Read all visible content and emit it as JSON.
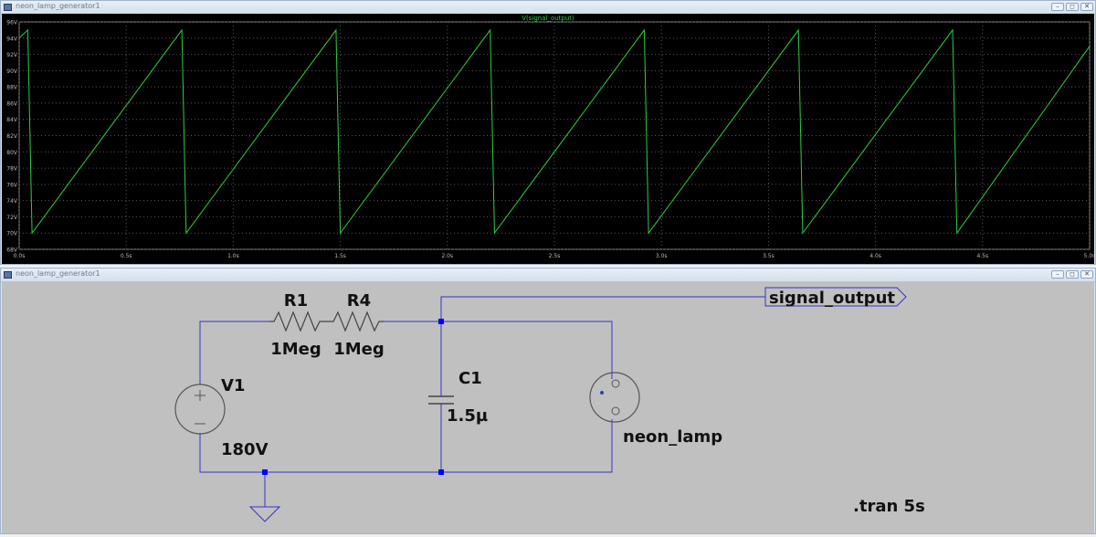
{
  "waveform_window": {
    "title": "neon_lamp_generator1",
    "trace_label": "V(signal_output)"
  },
  "schematic_window": {
    "title": "neon_lamp_generator1"
  },
  "window_controls": {
    "minimize": "–",
    "restore": "◻",
    "close": "✕"
  },
  "icons": {
    "app": "ltspice-app-icon",
    "minimize": "minimize-icon",
    "restore": "restore-icon",
    "close": "close-icon"
  },
  "colors": {
    "plot_background": "#000000",
    "trace": "#2ecc40",
    "grid": "#555555",
    "axis_text": "#bbbbbb",
    "wire": "#3333cc",
    "junction": "#0000ff",
    "schematic_background": "#c0c0c0"
  },
  "chart_data": {
    "type": "line",
    "title": "V(signal_output)",
    "xlabel": "",
    "ylabel": "",
    "xlim": [
      0,
      5
    ],
    "ylim": [
      68,
      96
    ],
    "x_ticks": [
      "0.0s",
      "0.5s",
      "1.0s",
      "1.5s",
      "2.0s",
      "2.5s",
      "3.0s",
      "3.5s",
      "4.0s",
      "4.5s",
      "5.0s"
    ],
    "x_tick_values": [
      0,
      0.5,
      1.0,
      1.5,
      2.0,
      2.5,
      3.0,
      3.5,
      4.0,
      4.5,
      5.0
    ],
    "y_ticks": [
      "68V",
      "70V",
      "72V",
      "74V",
      "76V",
      "78V",
      "80V",
      "82V",
      "84V",
      "86V",
      "88V",
      "90V",
      "92V",
      "94V",
      "96V"
    ],
    "y_tick_values": [
      68,
      70,
      72,
      74,
      76,
      78,
      80,
      82,
      84,
      86,
      88,
      90,
      92,
      94,
      96
    ],
    "grid": true,
    "series": [
      {
        "name": "V(signal_output)",
        "x": [
          0.0,
          0.04,
          0.06,
          0.76,
          0.78,
          1.48,
          1.5,
          2.2,
          2.22,
          2.92,
          2.94,
          3.64,
          3.66,
          4.36,
          4.38,
          5.0
        ],
        "y": [
          94.0,
          95.0,
          70.0,
          95.0,
          70.0,
          95.0,
          70.0,
          95.0,
          70.0,
          95.0,
          70.0,
          95.0,
          70.0,
          95.0,
          70.0,
          93.0
        ]
      }
    ]
  },
  "schematic": {
    "components": [
      {
        "ref": "R1",
        "value": "1Meg",
        "type": "resistor"
      },
      {
        "ref": "R4",
        "value": "1Meg",
        "type": "resistor"
      },
      {
        "ref": "C1",
        "value": "1.5µ",
        "type": "capacitor"
      },
      {
        "ref": "V1",
        "value": "180V",
        "type": "voltage-source"
      },
      {
        "ref": "neon_lamp",
        "type": "neon-lamp"
      }
    ],
    "net_label": "signal_output",
    "directive": ".tran 5s"
  }
}
